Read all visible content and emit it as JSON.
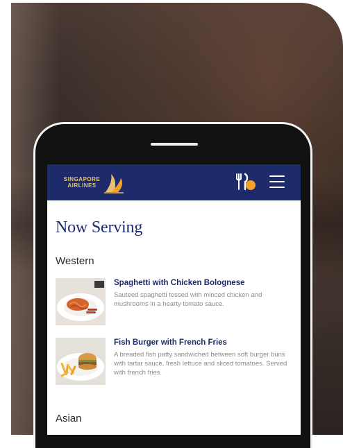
{
  "app": {
    "brand_line1": "SINGAPORE",
    "brand_line2": "AIRLINES",
    "brand_color": "#1d2b6b",
    "accent_color": "#e8c170",
    "badge_color": "#f2a02a"
  },
  "header": {
    "logo_icon": "singapore-airlines-bird-icon",
    "meal_icon": "fork-knife-icon",
    "menu_icon": "hamburger-menu-icon"
  },
  "page": {
    "title": "Now Serving"
  },
  "sections": [
    {
      "name": "Western",
      "items": [
        {
          "name": "Spaghetti with Chicken Bolognese",
          "description": "Sauteed spaghetti tossed with minced chicken and mushrooms in a hearty tomato sauce."
        },
        {
          "name": "Fish Burger with French Fries",
          "description": "A breaded fish patty sandwiched between soft burger buns with tartar sauce, fresh lettuce and sliced tomatoes. Served with french fries."
        }
      ]
    },
    {
      "name": "Asian",
      "items": []
    }
  ]
}
